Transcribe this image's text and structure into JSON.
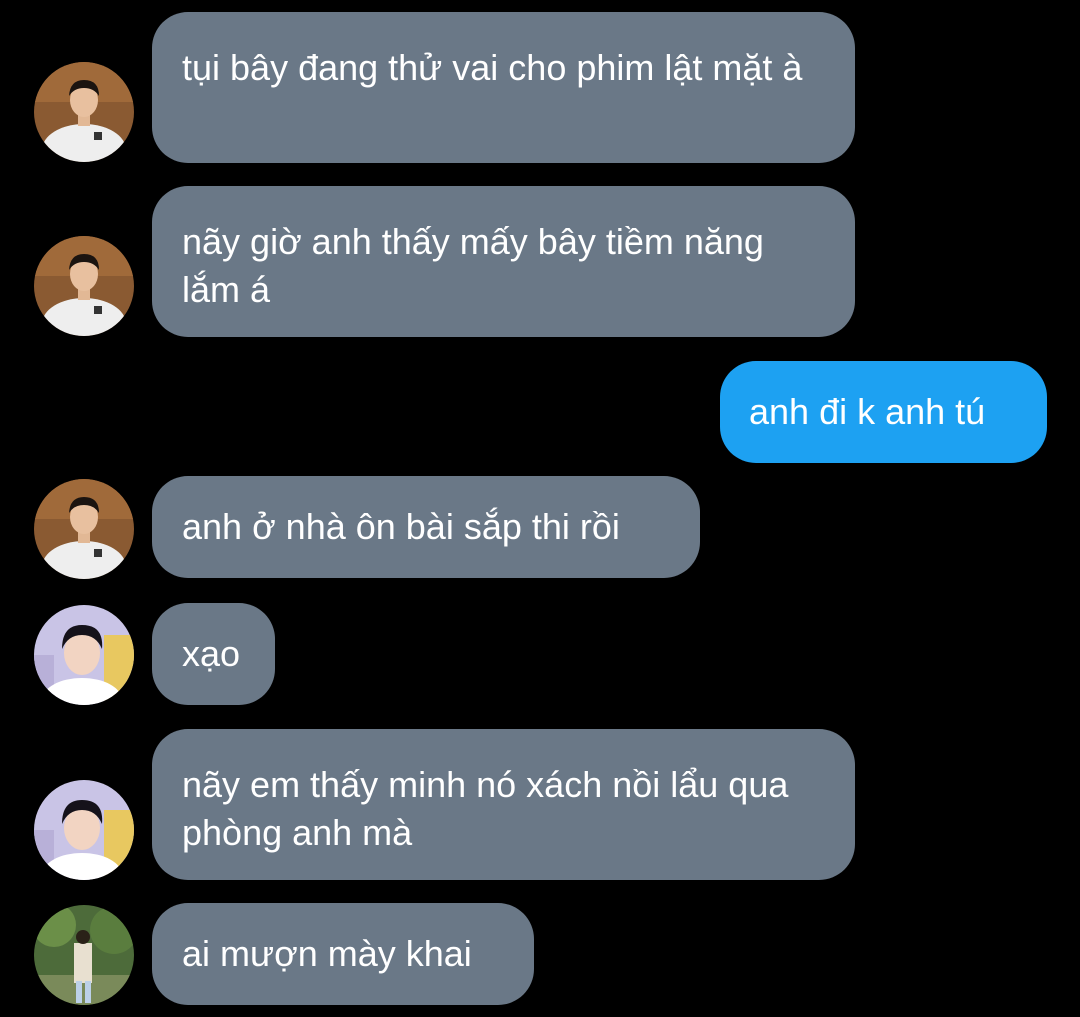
{
  "colors": {
    "background": "#000000",
    "incoming_bubble": "#6a7887",
    "outgoing_bubble": "#1da1f2",
    "text": "#ffffff"
  },
  "messages": [
    {
      "direction": "incoming",
      "avatar": "avatar-white-hoodie-icon",
      "text": "tụi bây đang thử vai cho phim lật mặt à"
    },
    {
      "direction": "incoming",
      "avatar": "avatar-white-hoodie-icon",
      "text": "nãy giờ anh thấy mấy bây tiềm năng lắm á"
    },
    {
      "direction": "outgoing",
      "text": "anh đi k anh tú"
    },
    {
      "direction": "incoming",
      "avatar": "avatar-white-hoodie-icon",
      "text": "anh ở nhà ôn bài sắp thi rồi"
    },
    {
      "direction": "incoming",
      "avatar": "avatar-smiling-boy-icon",
      "text": "xạo"
    },
    {
      "direction": "incoming",
      "avatar": "avatar-smiling-boy-icon",
      "text": "nãy em thấy minh nó xách nồi lẩu qua phòng anh mà"
    },
    {
      "direction": "incoming",
      "avatar": "avatar-forest-walk-icon",
      "text": "ai mượn mày khai"
    }
  ]
}
